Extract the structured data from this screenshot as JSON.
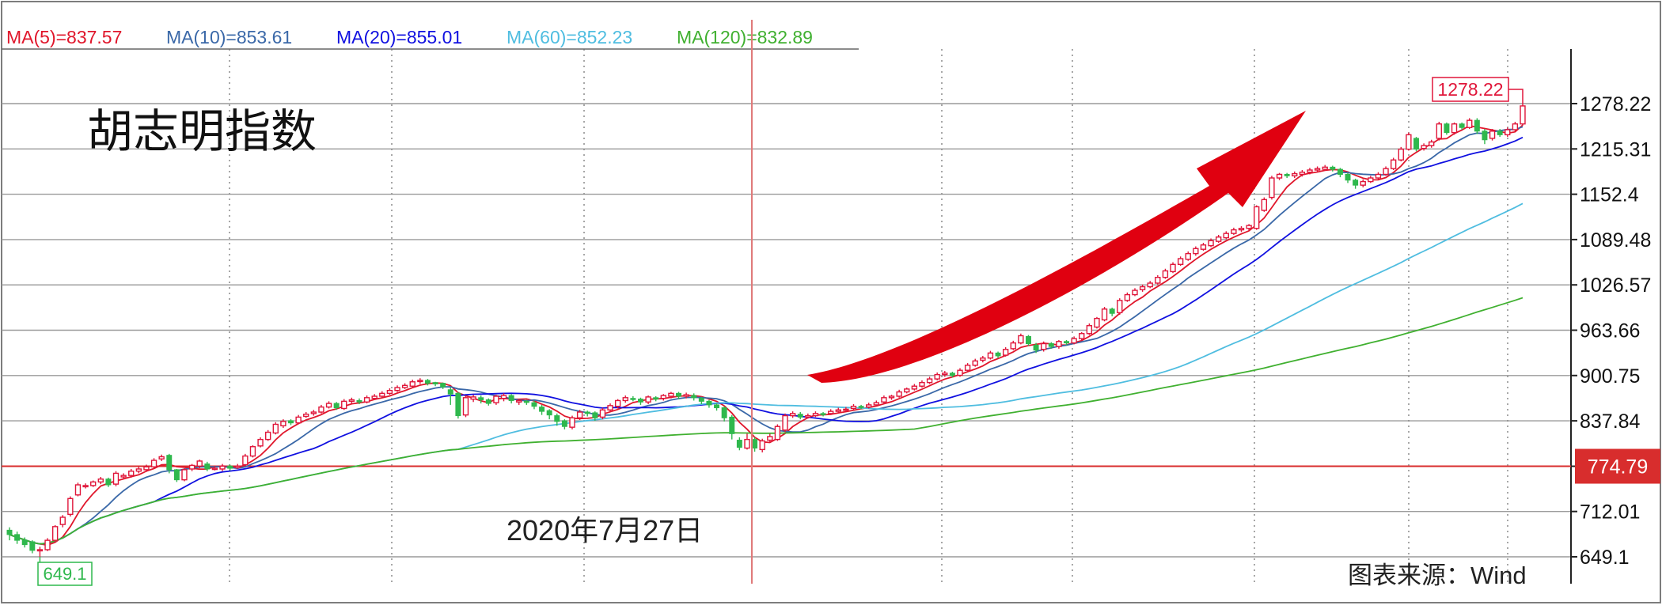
{
  "chart_data": {
    "type": "candlestick",
    "title": "胡志明指数",
    "source": "图表来源：Wind",
    "annotation_date": "2020年7月27日",
    "ma_legend": [
      {
        "label": "MA(5)=837.57",
        "color": "#e0162b"
      },
      {
        "label": "MA(10)=853.61",
        "color": "#3a68a8"
      },
      {
        "label": "MA(20)=855.01",
        "color": "#1010e0"
      },
      {
        "label": "MA(60)=852.23",
        "color": "#4fbde0"
      },
      {
        "label": "MA(120)=832.89",
        "color": "#40b030"
      }
    ],
    "y_ticks": [
      "1278.22",
      "1215.31",
      "1152.4",
      "1089.48",
      "1026.57",
      "963.66",
      "900.75",
      "837.84",
      "774.79",
      "712.01",
      "649.1"
    ],
    "ylim": [
      649.1,
      1278.22
    ],
    "reference_price": "774.79",
    "high_label": "1278.22",
    "low_label": "649.1",
    "colors": {
      "up": "#e0163a",
      "down": "#2fb84d",
      "reference": "#d82d2d",
      "arrow": "#e00010"
    },
    "candles": [
      [
        686,
        680,
        690,
        672
      ],
      [
        680,
        672,
        684,
        667
      ],
      [
        672,
        666,
        676,
        662
      ],
      [
        670,
        658,
        672,
        654
      ],
      [
        658,
        659,
        663,
        649.1
      ],
      [
        659,
        672,
        675,
        657
      ],
      [
        672,
        691,
        693,
        670
      ],
      [
        694,
        704,
        707,
        690
      ],
      [
        708,
        730,
        733,
        705
      ],
      [
        735,
        749,
        752,
        733
      ],
      [
        747,
        748,
        751,
        744
      ],
      [
        748,
        753,
        755,
        746
      ],
      [
        753,
        757,
        760,
        750
      ],
      [
        757,
        749,
        759,
        746
      ],
      [
        750,
        765,
        768,
        747
      ],
      [
        760,
        762,
        765,
        757
      ],
      [
        762,
        768,
        771,
        759
      ],
      [
        768,
        771,
        774,
        765
      ],
      [
        770,
        774,
        777,
        767
      ],
      [
        774,
        783,
        786,
        771
      ],
      [
        785,
        788,
        791,
        782
      ],
      [
        790,
        770,
        792,
        765
      ],
      [
        770,
        756,
        771,
        753
      ],
      [
        756,
        770,
        772,
        754
      ],
      [
        771,
        776,
        778,
        768
      ],
      [
        775,
        782,
        784,
        772
      ],
      [
        778,
        771,
        781,
        768
      ],
      [
        772,
        772,
        775,
        769
      ],
      [
        771,
        775,
        778,
        768
      ],
      [
        775,
        772,
        777,
        769
      ],
      [
        773,
        775,
        778,
        771
      ],
      [
        777,
        789,
        792,
        775
      ],
      [
        789,
        802,
        804,
        787
      ],
      [
        803,
        812,
        815,
        801
      ],
      [
        812,
        822,
        825,
        810
      ],
      [
        821,
        833,
        836,
        819
      ],
      [
        831,
        837,
        840,
        828
      ],
      [
        838,
        835,
        840,
        832
      ],
      [
        835,
        843,
        846,
        833
      ],
      [
        844,
        847,
        850,
        842
      ],
      [
        848,
        850,
        853,
        845
      ],
      [
        850,
        857,
        860,
        848
      ],
      [
        857,
        862,
        865,
        855
      ],
      [
        862,
        856,
        864,
        853
      ],
      [
        855,
        865,
        868,
        853
      ],
      [
        865,
        867,
        870,
        862
      ],
      [
        866,
        864,
        869,
        861
      ],
      [
        864,
        870,
        873,
        862
      ],
      [
        869,
        872,
        875,
        867
      ],
      [
        872,
        876,
        879,
        870
      ],
      [
        876,
        880,
        883,
        874
      ],
      [
        880,
        884,
        887,
        878
      ],
      [
        884,
        887,
        890,
        882
      ],
      [
        886,
        892,
        895,
        884
      ],
      [
        893,
        894,
        897,
        889
      ],
      [
        894,
        890,
        896,
        887
      ],
      [
        891,
        889,
        892,
        886
      ],
      [
        890,
        885,
        891,
        882
      ],
      [
        881,
        875,
        884,
        860
      ],
      [
        876,
        845,
        878,
        841
      ],
      [
        846,
        870,
        873,
        843
      ],
      [
        868,
        871,
        874,
        864
      ],
      [
        870,
        867,
        873,
        862
      ],
      [
        867,
        862,
        869,
        859
      ],
      [
        863,
        872,
        874,
        860
      ],
      [
        869,
        873,
        876,
        865
      ],
      [
        873,
        866,
        875,
        862
      ],
      [
        864,
        866,
        868,
        860
      ],
      [
        865,
        864,
        867,
        860
      ],
      [
        863,
        858,
        866,
        854
      ],
      [
        857,
        851,
        860,
        846
      ],
      [
        852,
        846,
        854,
        840
      ],
      [
        845,
        837,
        848,
        831
      ],
      [
        838,
        830,
        840,
        826
      ],
      [
        829,
        842,
        845,
        826
      ],
      [
        842,
        850,
        853,
        839
      ],
      [
        850,
        848,
        852,
        844
      ],
      [
        849,
        842,
        851,
        838
      ],
      [
        843,
        853,
        856,
        840
      ],
      [
        853,
        859,
        862,
        850
      ],
      [
        858,
        866,
        868,
        855
      ],
      [
        866,
        870,
        873,
        863
      ],
      [
        869,
        868,
        872,
        865
      ],
      [
        868,
        864,
        870,
        860
      ],
      [
        864,
        871,
        873,
        861
      ],
      [
        870,
        868,
        872,
        865
      ],
      [
        869,
        873,
        875,
        866
      ],
      [
        872,
        876,
        878,
        869
      ],
      [
        876,
        872,
        878,
        868
      ],
      [
        872,
        874,
        877,
        869
      ],
      [
        873,
        870,
        876,
        866
      ],
      [
        869,
        865,
        871,
        861
      ],
      [
        865,
        860,
        867,
        856
      ],
      [
        860,
        856,
        862,
        852
      ],
      [
        856,
        842,
        858,
        837
      ],
      [
        843,
        820,
        846,
        812
      ],
      [
        811,
        801,
        815,
        797
      ],
      [
        800,
        812,
        820,
        798
      ],
      [
        812,
        800,
        815,
        795
      ],
      [
        798,
        810,
        813,
        794
      ],
      [
        811,
        816,
        820,
        808
      ],
      [
        812,
        830,
        833,
        810
      ],
      [
        825,
        845,
        848,
        822
      ],
      [
        845,
        848,
        851,
        842
      ],
      [
        847,
        843,
        850,
        840
      ],
      [
        843,
        845,
        848,
        841
      ],
      [
        845,
        848,
        851,
        843
      ],
      [
        848,
        847,
        850,
        844
      ],
      [
        848,
        851,
        854,
        846
      ],
      [
        851,
        853,
        856,
        849
      ],
      [
        854,
        854,
        857,
        851
      ],
      [
        855,
        858,
        861,
        852
      ],
      [
        858,
        857,
        860,
        854
      ],
      [
        857,
        860,
        863,
        855
      ],
      [
        860,
        863,
        866,
        858
      ],
      [
        864,
        870,
        873,
        862
      ],
      [
        870,
        872,
        874,
        867
      ],
      [
        872,
        878,
        881,
        870
      ],
      [
        878,
        882,
        884,
        876
      ],
      [
        882,
        886,
        889,
        880
      ],
      [
        886,
        891,
        894,
        884
      ],
      [
        891,
        896,
        899,
        889
      ],
      [
        896,
        902,
        905,
        894
      ],
      [
        902,
        904,
        907,
        899
      ],
      [
        904,
        901,
        906,
        898
      ],
      [
        901,
        908,
        911,
        899
      ],
      [
        908,
        915,
        918,
        906
      ],
      [
        915,
        921,
        924,
        913
      ],
      [
        922,
        925,
        928,
        919
      ],
      [
        925,
        932,
        935,
        923
      ],
      [
        932,
        928,
        934,
        925
      ],
      [
        929,
        937,
        940,
        927
      ],
      [
        938,
        946,
        949,
        936
      ],
      [
        946,
        956,
        959,
        944
      ],
      [
        955,
        945,
        957,
        942
      ],
      [
        943,
        936,
        946,
        932
      ],
      [
        937,
        945,
        948,
        934
      ],
      [
        945,
        941,
        947,
        938
      ],
      [
        941,
        948,
        950,
        938
      ],
      [
        948,
        946,
        950,
        943
      ],
      [
        946,
        952,
        955,
        944
      ],
      [
        952,
        959,
        961,
        949
      ],
      [
        959,
        970,
        973,
        957
      ],
      [
        968,
        980,
        982,
        966
      ],
      [
        978,
        993,
        996,
        976
      ],
      [
        993,
        987,
        995,
        983
      ],
      [
        988,
        1005,
        1008,
        985
      ],
      [
        1005,
        1013,
        1016,
        1003
      ],
      [
        1013,
        1019,
        1022,
        1011
      ],
      [
        1020,
        1024,
        1027,
        1017
      ],
      [
        1024,
        1029,
        1032,
        1022
      ],
      [
        1029,
        1037,
        1040,
        1027
      ],
      [
        1037,
        1046,
        1049,
        1035
      ],
      [
        1045,
        1055,
        1058,
        1043
      ],
      [
        1055,
        1063,
        1066,
        1053
      ],
      [
        1062,
        1070,
        1073,
        1060
      ],
      [
        1070,
        1077,
        1080,
        1067
      ],
      [
        1076,
        1082,
        1085,
        1074
      ],
      [
        1081,
        1088,
        1091,
        1079
      ],
      [
        1087,
        1093,
        1096,
        1085
      ],
      [
        1092,
        1098,
        1101,
        1090
      ],
      [
        1098,
        1103,
        1106,
        1096
      ],
      [
        1103,
        1105,
        1108,
        1100
      ],
      [
        1105,
        1109,
        1111,
        1102
      ],
      [
        1105,
        1135,
        1137,
        1103
      ],
      [
        1130,
        1145,
        1148,
        1128
      ],
      [
        1148,
        1175,
        1178,
        1145
      ],
      [
        1175,
        1180,
        1182,
        1172
      ],
      [
        1180,
        1178,
        1182,
        1175
      ],
      [
        1178,
        1181,
        1184,
        1175
      ],
      [
        1180,
        1183,
        1186,
        1177
      ],
      [
        1183,
        1186,
        1189,
        1180
      ],
      [
        1186,
        1188,
        1191,
        1183
      ],
      [
        1187,
        1190,
        1193,
        1185
      ],
      [
        1190,
        1187,
        1192,
        1184
      ],
      [
        1187,
        1180,
        1189,
        1176
      ],
      [
        1180,
        1172,
        1182,
        1168
      ],
      [
        1172,
        1165,
        1174,
        1160
      ],
      [
        1165,
        1170,
        1173,
        1162
      ],
      [
        1170,
        1175,
        1178,
        1168
      ],
      [
        1175,
        1180,
        1183,
        1173
      ],
      [
        1180,
        1188,
        1191,
        1178
      ],
      [
        1188,
        1200,
        1203,
        1186
      ],
      [
        1200,
        1215,
        1218,
        1198
      ],
      [
        1215,
        1235,
        1238,
        1213
      ],
      [
        1230,
        1215,
        1232,
        1212
      ],
      [
        1216,
        1220,
        1223,
        1213
      ],
      [
        1220,
        1225,
        1228,
        1217
      ],
      [
        1230,
        1250,
        1253,
        1227
      ],
      [
        1250,
        1238,
        1252,
        1235
      ],
      [
        1238,
        1250,
        1252,
        1235
      ],
      [
        1250,
        1245,
        1252,
        1242
      ],
      [
        1245,
        1255,
        1258,
        1243
      ],
      [
        1255,
        1240,
        1258,
        1236
      ],
      [
        1240,
        1228,
        1243,
        1222
      ],
      [
        1230,
        1240,
        1243,
        1227
      ],
      [
        1240,
        1235,
        1243,
        1232
      ],
      [
        1235,
        1242,
        1245,
        1232
      ],
      [
        1242,
        1250,
        1253,
        1240
      ],
      [
        1250,
        1275,
        1278.22,
        1248
      ]
    ]
  }
}
